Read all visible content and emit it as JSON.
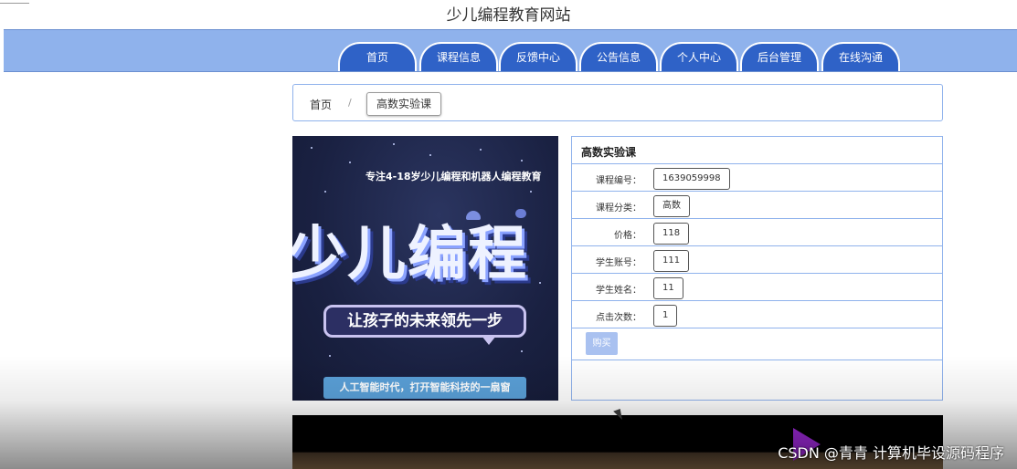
{
  "site": {
    "title": "少儿编程教育网站"
  },
  "nav": {
    "tabs": [
      {
        "label": "首页"
      },
      {
        "label": "课程信息"
      },
      {
        "label": "反馈中心"
      },
      {
        "label": "公告信息"
      },
      {
        "label": "个人中心"
      },
      {
        "label": "后台管理"
      },
      {
        "label": "在线沟通"
      }
    ]
  },
  "breadcrumb": {
    "home": "首页",
    "separator": "/",
    "current": "高数实验课"
  },
  "banner": {
    "subtitle": "专注4-18岁少儿编程和机器人编程教育",
    "headline": "少儿编程",
    "slogan": "让孩子的未来领先一步",
    "footer": "人工智能时代，打开智能科技的一扇窗"
  },
  "details": {
    "title": "高数实验课",
    "fields": [
      {
        "label": "课程编号：",
        "value": "1639059998"
      },
      {
        "label": "课程分类：",
        "value": "高数"
      },
      {
        "label": "价格：",
        "value": "118"
      },
      {
        "label": "学生账号：",
        "value": "111"
      },
      {
        "label": "学生姓名：",
        "value": "11"
      },
      {
        "label": "点击次数：",
        "value": "1"
      }
    ],
    "buy_label": "购买"
  },
  "watermark": "CSDN @青青  计算机毕设源码程序",
  "colors": {
    "nav_bar": "#8fb2ec",
    "tab": "#2f62c7",
    "border": "#8fb2ec",
    "buy_button": "#a9c1f0"
  }
}
